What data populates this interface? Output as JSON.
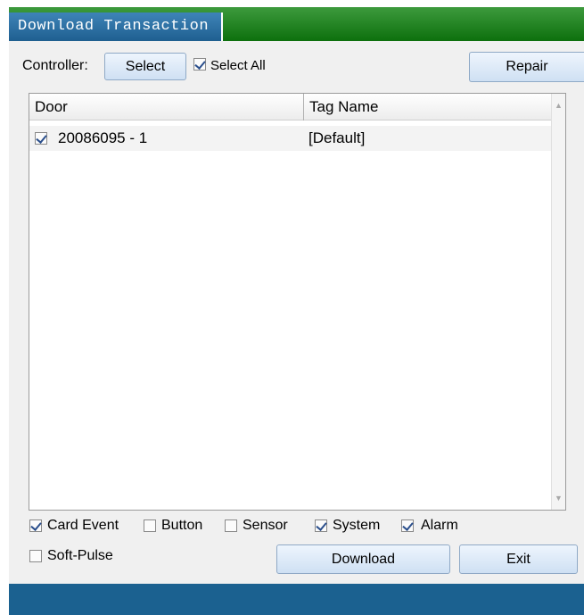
{
  "window": {
    "title": "Download Transaction"
  },
  "controller": {
    "label": "Controller:",
    "select_button": "Select",
    "select_all_label": "Select All",
    "select_all_checked": true
  },
  "repair_button": "Repair",
  "table": {
    "columns": [
      "Door",
      "Tag Name"
    ],
    "rows": [
      {
        "checked": true,
        "door": "20086095 - 1",
        "tag_name": "[Default]"
      }
    ]
  },
  "filters": [
    {
      "label": "Card Event",
      "checked": true
    },
    {
      "label": "Button",
      "checked": false
    },
    {
      "label": "Sensor",
      "checked": false
    },
    {
      "label": "System",
      "checked": true
    },
    {
      "label": "Alarm",
      "checked": true
    }
  ],
  "soft_pulse": {
    "label": "Soft-Pulse",
    "checked": false
  },
  "download_button": "Download",
  "exit_button": "Exit",
  "colors": {
    "title_green": "#0d700d",
    "tab_blue": "#1f5f90",
    "status_blue": "#1b6190"
  }
}
